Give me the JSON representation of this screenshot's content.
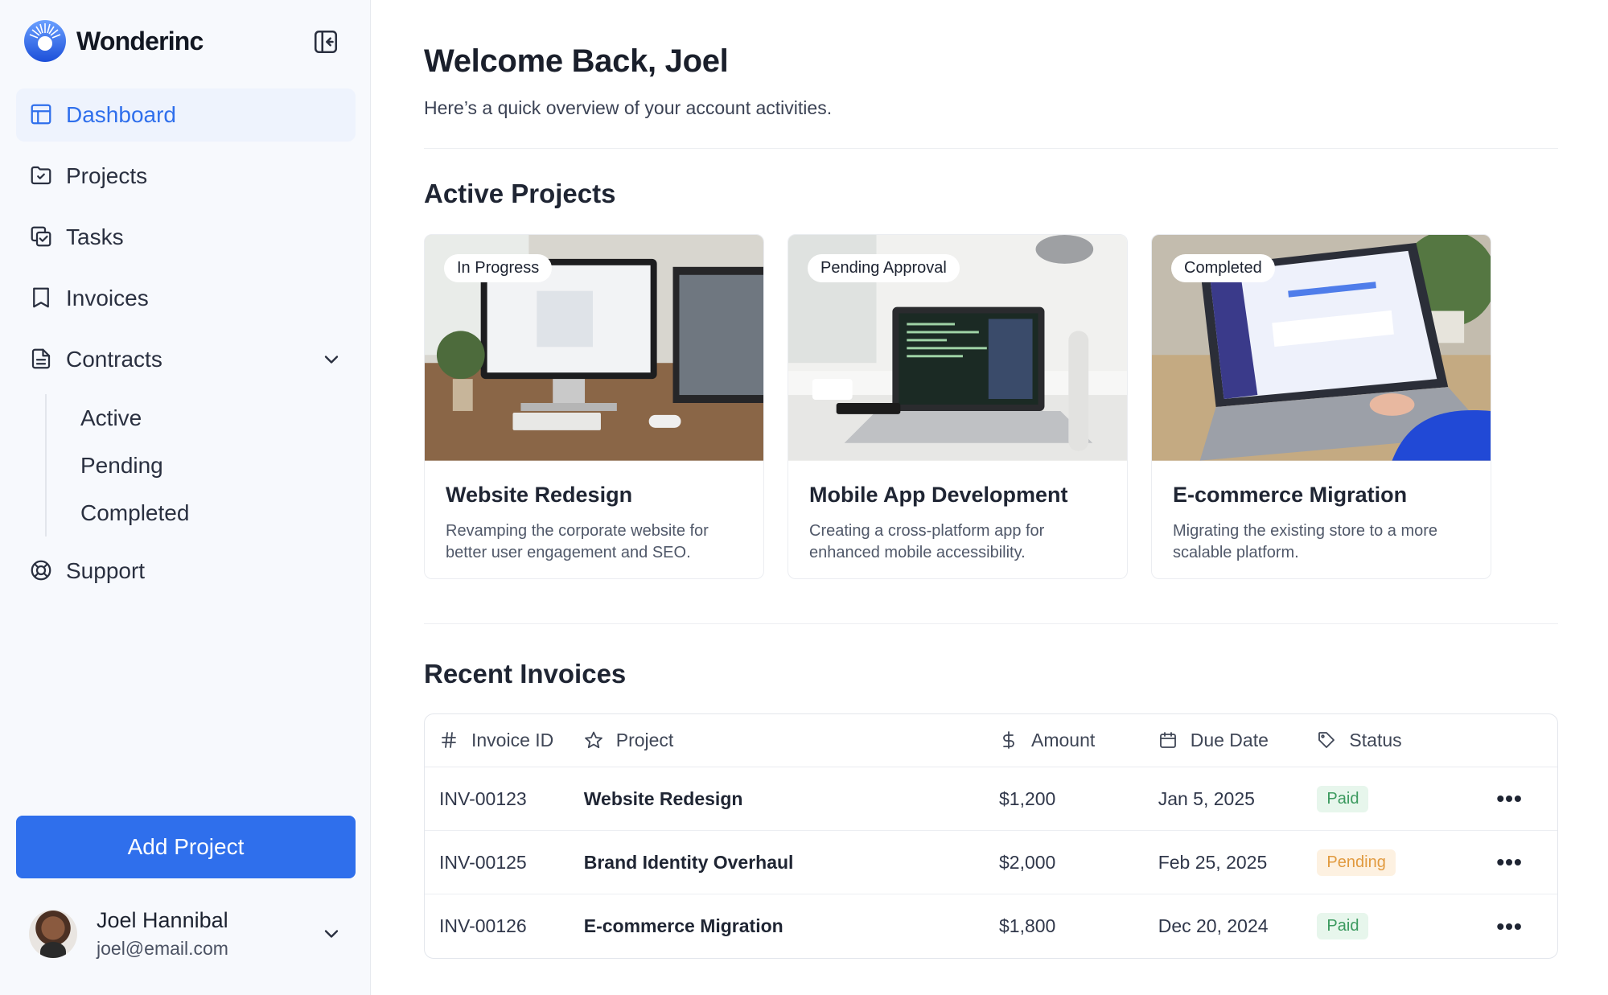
{
  "brand": {
    "name": "Wonderinc"
  },
  "sidebar": {
    "items": [
      {
        "label": "Dashboard",
        "icon": "dashboard-icon"
      },
      {
        "label": "Projects",
        "icon": "folder-check-icon"
      },
      {
        "label": "Tasks",
        "icon": "copy-check-icon"
      },
      {
        "label": "Invoices",
        "icon": "receipt-icon"
      },
      {
        "label": "Contracts",
        "icon": "file-text-icon"
      },
      {
        "label": "Support",
        "icon": "lifebuoy-icon"
      }
    ],
    "contracts_sub": [
      "Active",
      "Pending",
      "Completed"
    ],
    "add_button": "Add Project",
    "user": {
      "name": "Joel Hannibal",
      "email": "joel@email.com"
    }
  },
  "header": {
    "title": "Welcome Back, Joel",
    "subtitle": "Here’s a quick overview of your account activities."
  },
  "projects": {
    "title": "Active Projects",
    "cards": [
      {
        "badge": "In Progress",
        "title": "Website Redesign",
        "desc": "Revamping the corporate website for better user engagement and SEO."
      },
      {
        "badge": "Pending Approval",
        "title": "Mobile App Development",
        "desc": "Creating a cross-platform app for enhanced mobile accessibility."
      },
      {
        "badge": "Completed",
        "title": "E-commerce Migration",
        "desc": "Migrating the existing store to a more scalable platform."
      }
    ]
  },
  "invoices": {
    "title": "Recent Invoices",
    "columns": [
      "Invoice ID",
      "Project",
      "Amount",
      "Due Date",
      "Status"
    ],
    "rows": [
      {
        "id": "INV-00123",
        "project": "Website Redesign",
        "amount": "$1,200",
        "due": "Jan 5, 2025",
        "status": "Paid"
      },
      {
        "id": "INV-00125",
        "project": "Brand Identity Overhaul",
        "amount": "$2,000",
        "due": "Feb 25, 2025",
        "status": "Pending"
      },
      {
        "id": "INV-00126",
        "project": "E-commerce Migration",
        "amount": "$1,800",
        "due": "Dec 20, 2024",
        "status": "Paid"
      }
    ],
    "actions_glyph": "•••"
  },
  "colors": {
    "accent": "#2f6fec",
    "paid_bg": "#e7f6ec",
    "paid_fg": "#3c9a5f",
    "pending_bg": "#fdf1e1",
    "pending_fg": "#e19a3f"
  }
}
